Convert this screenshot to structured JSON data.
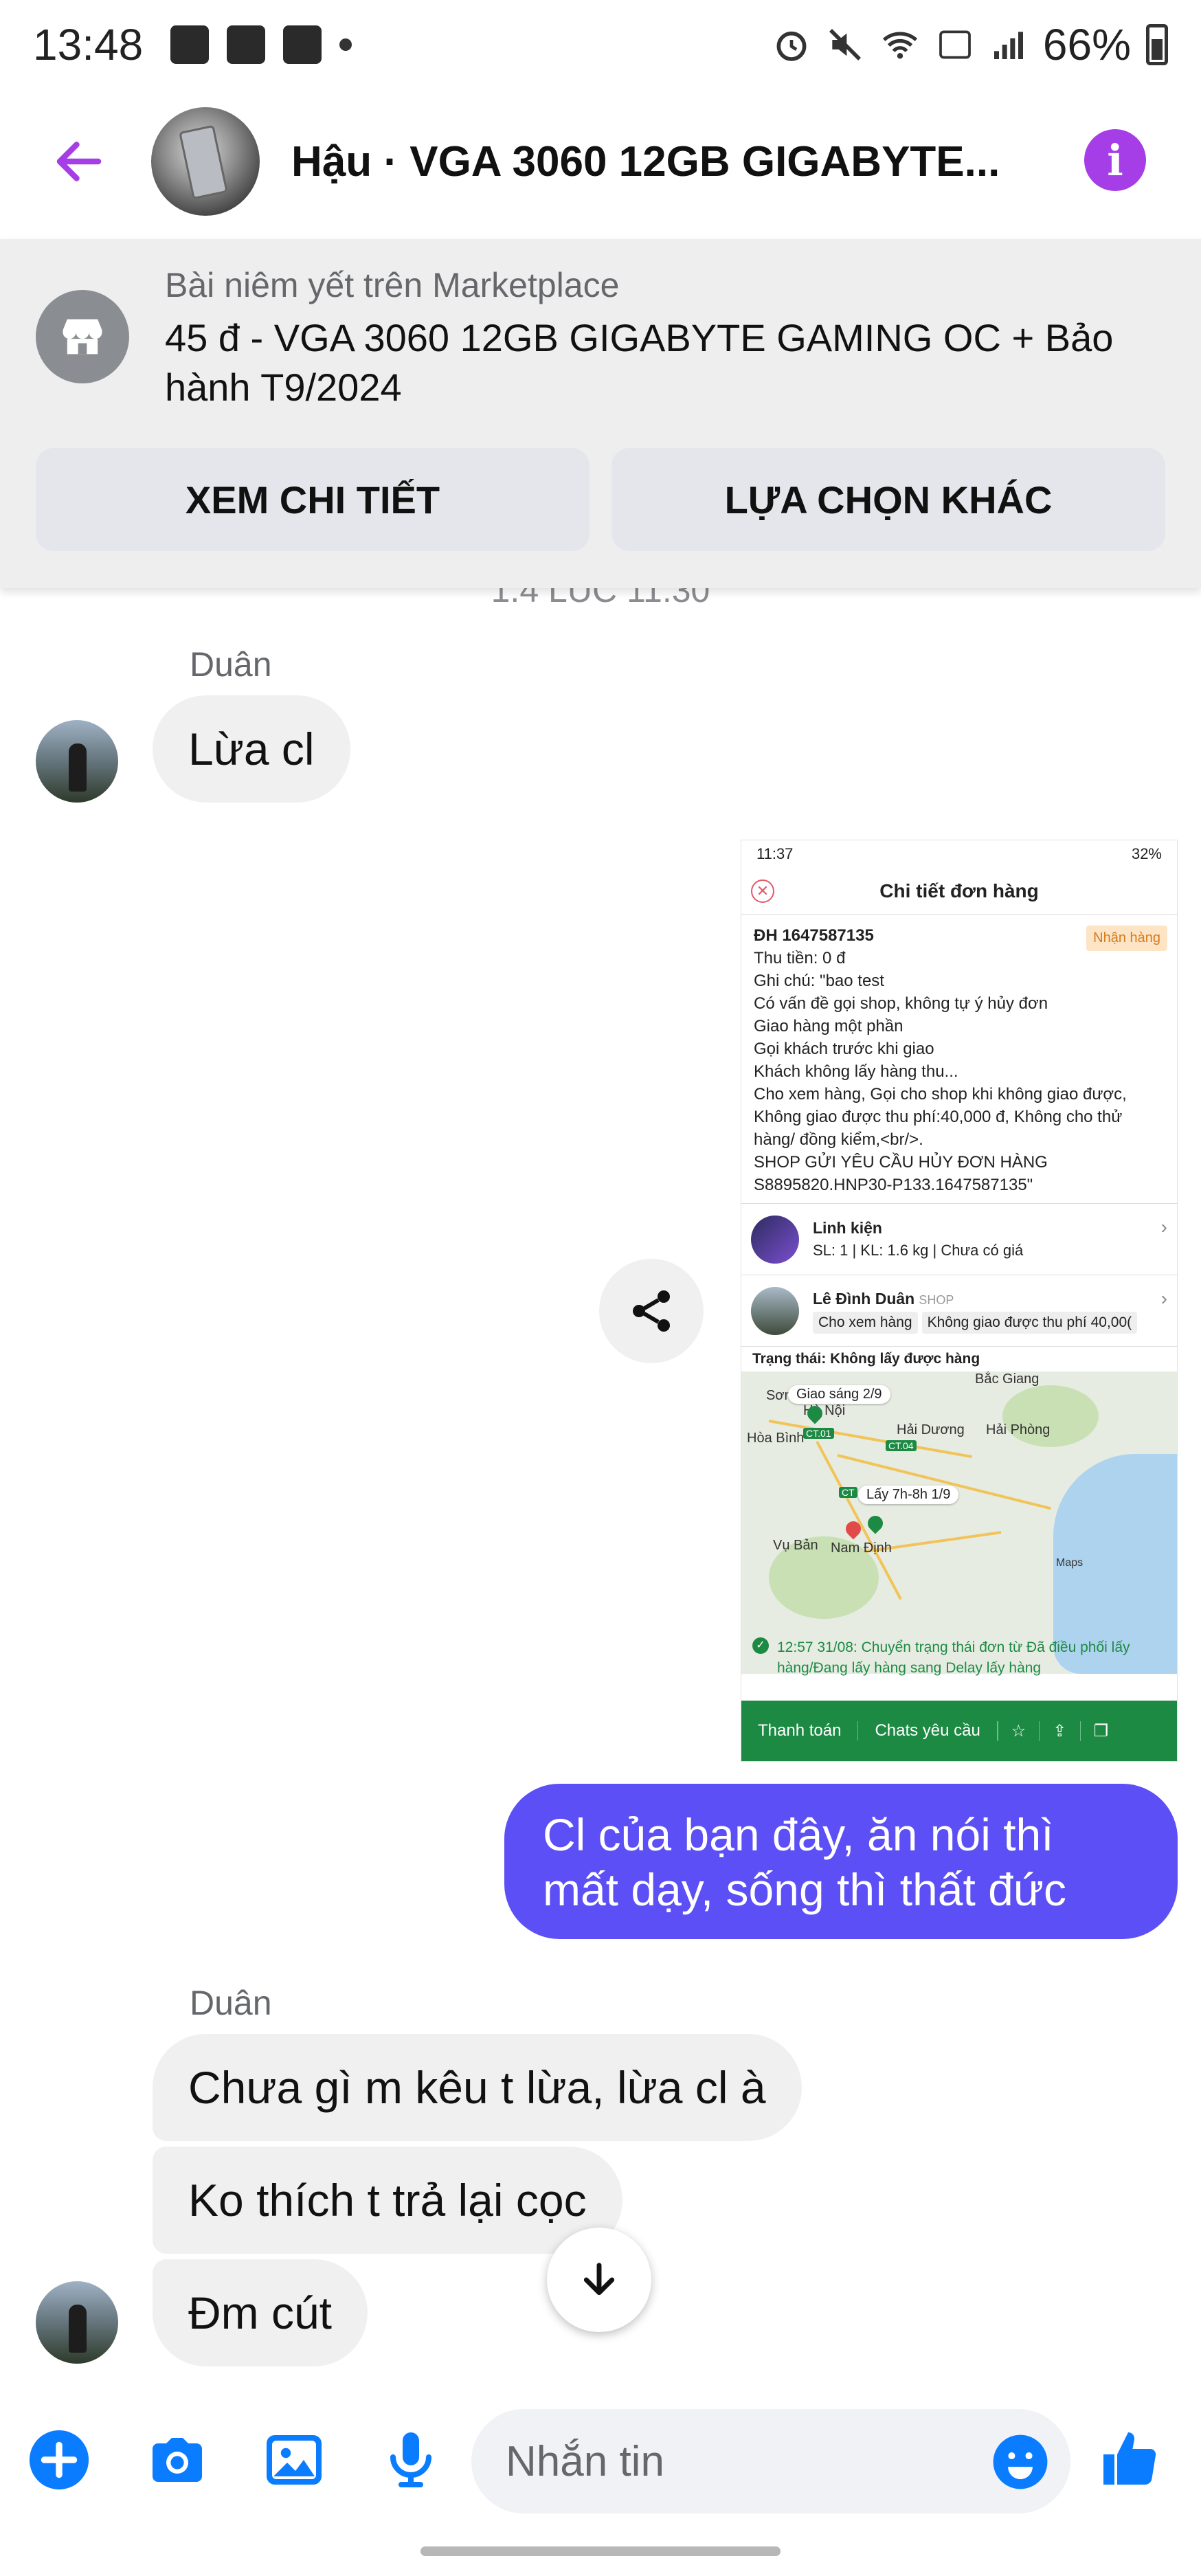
{
  "status_bar": {
    "time": "13:48",
    "battery": "66%"
  },
  "header": {
    "title": "Hậu · VGA 3060 12GB GIGABYTE..."
  },
  "marketplace": {
    "subtitle": "Bài niêm yết trên Marketplace",
    "listing": "45 đ - VGA 3060 12GB GIGABYTE GAMING OC + Bảo hành T9/2024",
    "btn_details": "XEM CHI TIẾT",
    "btn_other": "LỰA CHỌN KHÁC"
  },
  "cutoff_timestamp": "1.4 LÚC 11:30",
  "messages": {
    "sender1": "Duân",
    "m1": "Lừa cl",
    "outgoing": "Cl của bạn đây, ăn nói thì mất dạy, sống thì thất đức",
    "sender2": "Duân",
    "m2": "Chưa gì m kêu t lừa, lừa cl à",
    "m3": "Ko thích t trả lại cọc",
    "m4": "Đm cút"
  },
  "shared_image": {
    "time": "11:37",
    "battery": "32%",
    "title": "Chi tiết đơn hàng",
    "order_id": "ĐH 1647587135",
    "badge": "Nhận hàng",
    "lines": [
      "Thu tiền: 0 đ",
      "Ghi chú: \"bao test",
      "Có vấn đề gọi shop, không tự ý hủy đơn",
      "Giao hàng một phần",
      "Gọi khách trước khi giao",
      "Khách không lấy hàng thu...",
      " Cho xem hàng, Gọi cho shop khi không giao được,",
      "Không giao được thu phí:40,000 đ, Không cho thử",
      "hàng/ đồng kiểm,<br/>.",
      "SHOP GỬI YÊU CẦU HỦY ĐƠN HÀNG",
      "S8895820.HNP30-P133.1647587135\""
    ],
    "product_name": "Linh kiện",
    "product_meta": "SL: 1 | KL: 1.6 kg | Chưa có giá",
    "shop_name": "Lê Đình Duân",
    "shop_tag": "SHOP",
    "chip1": "Cho xem hàng",
    "chip2": "Không giao được thu phí 40,00(",
    "status": "Trạng thái: Không lấy được hàng",
    "map_labels": {
      "delivery": "Giao sáng 2/9",
      "pickup": "Lấy 7h-8h 1/9",
      "bac_giang": "Bắc Giang",
      "son_tay": "Sơn Tây",
      "ha_noi": "Hà Nội",
      "hai_duong": "Hải Dương",
      "hai_phong": "Hải Phòng",
      "hoa_binh": "Hòa Bình",
      "vu_ban": "Vụ Bản",
      "nam_dinh": "Nam Định",
      "maps": "Maps"
    },
    "log": "12:57 31/08: Chuyển trạng thái đơn từ Đã điều phối lấy hàng/Đang lấy hàng sang Delay lấy hàng",
    "footer_pay": "Thanh toán",
    "footer_chat": "Chats yêu cầu"
  },
  "composer": {
    "placeholder": "Nhắn tin"
  },
  "colors": {
    "accent": "#a53ee6",
    "outgoing_bubble": "#5b4ff5",
    "icon_blue": "#0a7cff"
  }
}
